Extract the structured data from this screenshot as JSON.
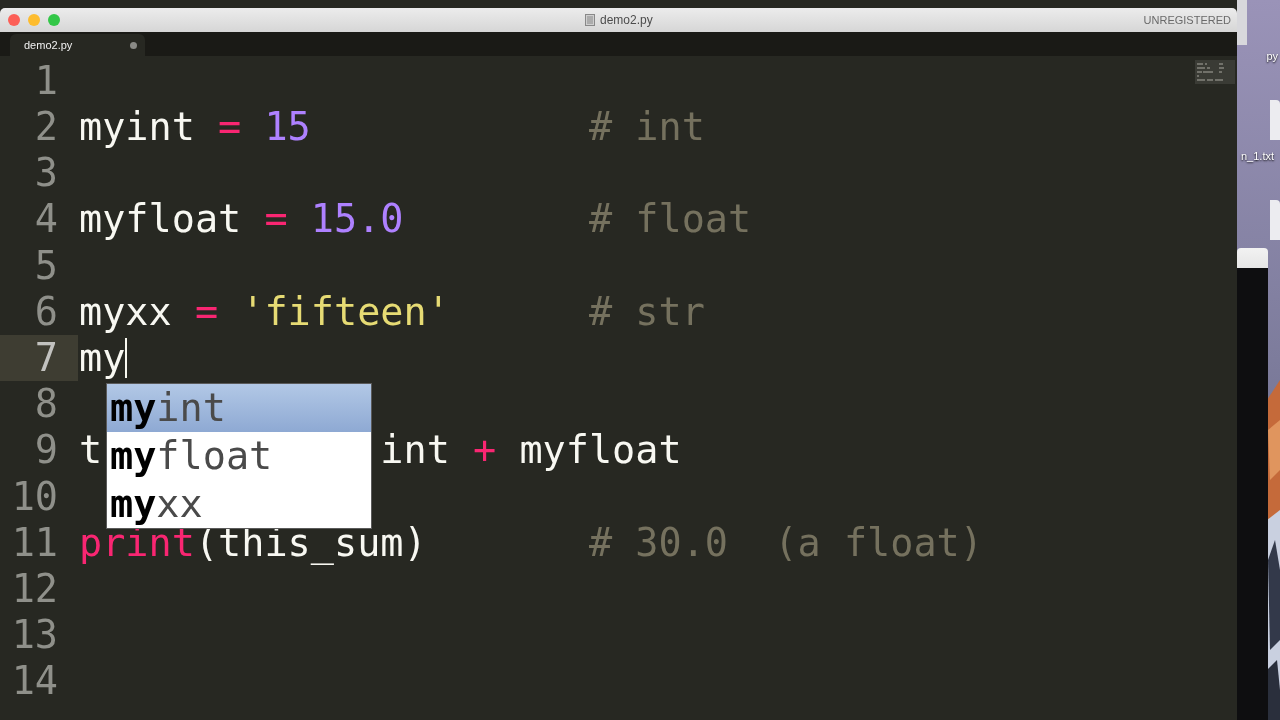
{
  "window": {
    "title": "demo2.py",
    "license_label": "UNREGISTERED"
  },
  "tabs": [
    {
      "label": "demo2.py",
      "selected": true,
      "modified": true
    }
  ],
  "editor": {
    "lines": [
      {
        "number": "1",
        "current": false
      },
      {
        "number": "2",
        "current": false,
        "tokens": [
          {
            "text": "myint ",
            "kind": "name"
          },
          {
            "text": "= ",
            "kind": "operator"
          },
          {
            "text": "15",
            "kind": "number"
          }
        ],
        "comment": "# int"
      },
      {
        "number": "3",
        "current": false
      },
      {
        "number": "4",
        "current": false,
        "tokens": [
          {
            "text": "myfloat ",
            "kind": "name"
          },
          {
            "text": "= ",
            "kind": "operator"
          },
          {
            "text": "15.0",
            "kind": "number"
          }
        ],
        "comment": "# float"
      },
      {
        "number": "5",
        "current": false
      },
      {
        "number": "6",
        "current": false,
        "tokens": [
          {
            "text": "myxx ",
            "kind": "name"
          },
          {
            "text": "= ",
            "kind": "operator"
          },
          {
            "text": "'fifteen'",
            "kind": "string"
          }
        ],
        "comment": "# str"
      },
      {
        "number": "7",
        "current": true,
        "cursor": true,
        "tokens": [
          {
            "text": "my",
            "kind": "name"
          }
        ]
      },
      {
        "number": "8",
        "current": false
      },
      {
        "number": "9",
        "current": false,
        "tokens": [
          {
            "text": "t",
            "kind": "name"
          }
        ],
        "after_popup": [
          {
            "text": "int ",
            "kind": "name"
          },
          {
            "text": "+ ",
            "kind": "operator"
          },
          {
            "text": "myfloat",
            "kind": "name"
          }
        ]
      },
      {
        "number": "10",
        "current": false
      },
      {
        "number": "11",
        "current": false,
        "tokens": [
          {
            "text": "print",
            "kind": "keyword"
          },
          {
            "text": "(this_sum)",
            "kind": "name"
          }
        ],
        "comment": "# 30.0  (a float)"
      },
      {
        "number": "12",
        "current": false
      },
      {
        "number": "13",
        "current": false
      },
      {
        "number": "14",
        "current": false
      }
    ],
    "autocomplete": [
      {
        "text": "**my**int",
        "selected": true
      },
      {
        "text": "**my**float",
        "selected": false
      },
      {
        "text": "**my**xx",
        "selected": false
      }
    ]
  },
  "desktop": {
    "icons": [
      {
        "label": "py"
      },
      {
        "label": "n_1.txt"
      }
    ]
  }
}
